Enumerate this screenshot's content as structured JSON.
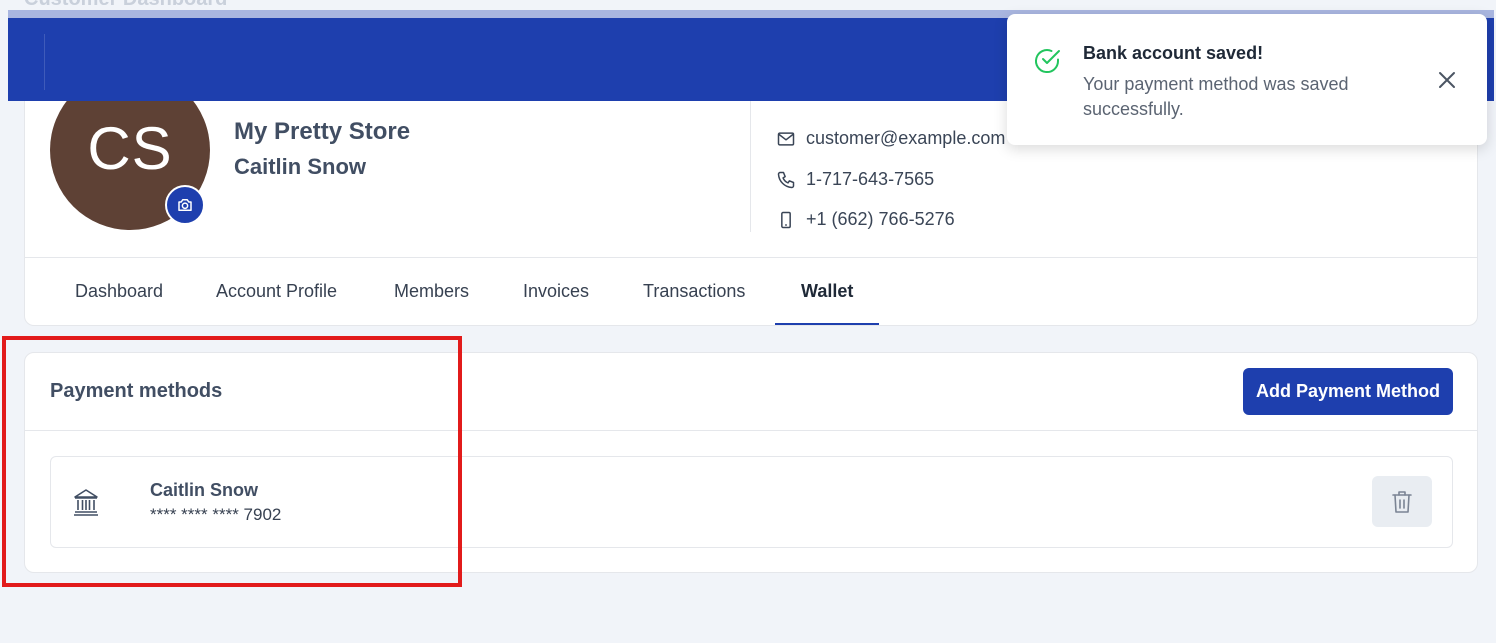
{
  "page": {
    "title": "Customer Dashboard"
  },
  "profile": {
    "initials": "CS",
    "avatar_color": "#5e4135",
    "store_name": "My Pretty Store",
    "customer_name": "Caitlin Snow",
    "email": "customer@example.com",
    "phone": "1-717-643-7565",
    "mobile": "+1 (662) 766-5276"
  },
  "tabs": [
    {
      "label": "Dashboard",
      "active": false
    },
    {
      "label": "Account Profile",
      "active": false
    },
    {
      "label": "Members",
      "active": false
    },
    {
      "label": "Invoices",
      "active": false
    },
    {
      "label": "Transactions",
      "active": false
    },
    {
      "label": "Wallet",
      "active": true
    }
  ],
  "payment_methods": {
    "title": "Payment methods",
    "add_button_label": "Add Payment Method",
    "items": [
      {
        "icon": "bank-icon",
        "name": "Caitlin Snow",
        "masked_number": "**** **** **** 7902"
      }
    ]
  },
  "toast": {
    "title": "Bank account saved!",
    "message": "Your payment method was saved successfully.",
    "icon": "check-circle-icon",
    "color": "#22c55e"
  },
  "colors": {
    "brand": "#1e3fae",
    "highlight": "#e21b1b"
  }
}
